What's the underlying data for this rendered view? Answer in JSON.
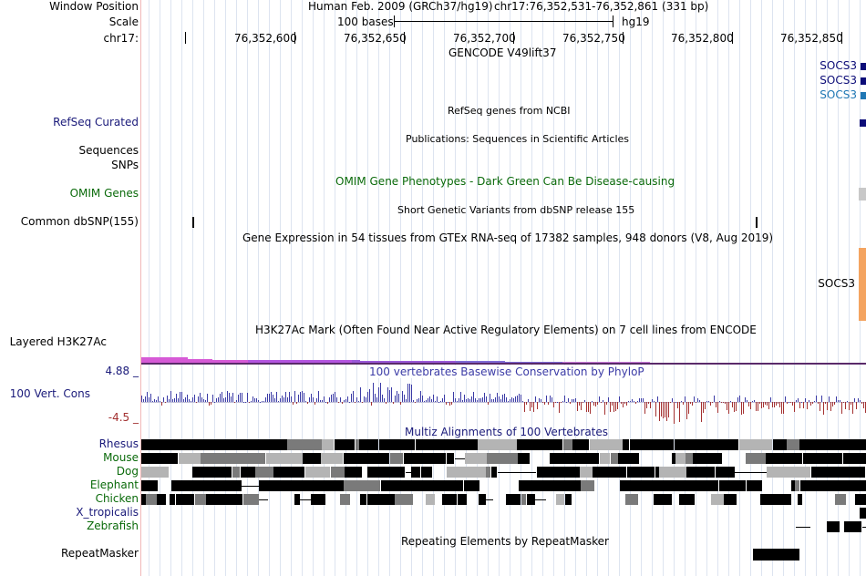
{
  "header": {
    "assembly": "Human Feb. 2009 (GRCh37/hg19)",
    "position": "chr17:76,352,531-76,352,861 (331 bp)",
    "scale_label": "100 bases",
    "scale_db": "hg19",
    "coords": [
      "76,352,600",
      "76,352,650",
      "76,352,700",
      "76,352,750",
      "76,352,800",
      "76,352,850"
    ]
  },
  "labels": {
    "window_position": "Window Position",
    "scale": "Scale",
    "chrom": "chr17:",
    "refseq": "RefSeq Curated",
    "sequences": "Sequences",
    "snps": "SNPs",
    "omim": "OMIM Genes",
    "common_dbsnp": "Common dbSNP(155)",
    "layered_h3k27ac": "Layered H3K27Ac",
    "cons_top": "4.88 _",
    "cons_name": "100 Vert. Cons",
    "cons_bottom": "-4.5 _",
    "repeatmasker": "RepeatMasker"
  },
  "species": [
    "Rhesus",
    "Mouse",
    "Dog",
    "Elephant",
    "Chicken",
    "X_tropicalis",
    "Zebrafish"
  ],
  "tracks": {
    "gencode": "GENCODE V49lift37",
    "gencode_genes": [
      "SOCS3",
      "SOCS3",
      "SOCS3"
    ],
    "refseq": "RefSeq genes from NCBI",
    "publications": "Publications: Sequences in Scientific Articles",
    "omim": "OMIM Gene Phenotypes - Dark Green Can Be Disease-causing",
    "dbsnp": "Short Genetic Variants from dbSNP release 155",
    "gtex": "Gene Expression in 54 tissues from GTEx RNA-seq of 17382 samples, 948 donors (V8, Aug 2019)",
    "gtex_gene": "SOCS3",
    "h3k27ac": "H3K27Ac Mark (Often Found Near Active Regulatory Elements) on 7 cell lines from ENCODE",
    "phylop": "100 vertebrates Basewise Conservation by PhyloP",
    "multiz": "Multiz Alignments of 100 Vertebrates",
    "repeatmasker": "Repeating Elements by RepeatMasker"
  },
  "colors": {
    "gene_dark": "#0c0c78",
    "gene_light": "#1f77b4",
    "label_blue": "#1a1a7a",
    "omim_green": "#0a6a0a",
    "species_green": "#0a6a0a",
    "cons_pos": "#3b3ba6",
    "cons_neg": "#a33131",
    "gtex_orange": "#f4a460",
    "grid": "#dde4f0"
  }
}
